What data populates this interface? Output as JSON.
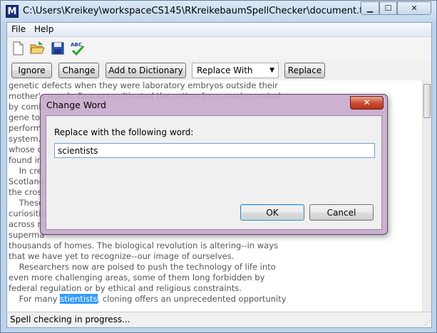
{
  "window": {
    "app_icon": "M",
    "title": "C:\\Users\\Kreikey\\workspaceCS145\\RKreikebaumSpellChecker\\document.txt",
    "min_glyph": "▁",
    "max_glyph": "☐",
    "close_glyph": "✕"
  },
  "menu": {
    "file": "File",
    "help": "Help"
  },
  "toolbar": {
    "icons": [
      "new-file-icon",
      "open-folder-icon",
      "save-disk-icon",
      "spellcheck-abc-icon"
    ],
    "abc_text": "ABC"
  },
  "actions": {
    "ignore": "Ignore",
    "change": "Change",
    "add_to_dictionary": "Add to Dictionary",
    "combo_value": "Replace With",
    "combo_arrow": "▼",
    "replace": "Replace"
  },
  "document": {
    "lines": [
      "genetic defects when they were laboratory embryos outside their",
      "mother's womb. Farmers cultivated the cotton from seeds created",
      "by comb",
      "gene to",
      "perform",
      "system.",
      "whose c",
      "found in",
      "    In cre",
      "Scotland",
      "the cross",
      "    These",
      "curiositie",
      "across m",
      "superma",
      "thousands of homes. The biological revolution is altering--in ways",
      "that we have yet to recognize--our image of ourselves.",
      "    Researchers now are poised to push the technology of life into",
      "even more challenging areas, some of them long forbidden by",
      "federal regulation or by ethical and religious constraints."
    ],
    "last_line_prefix": "    For many ",
    "last_line_highlight": "stientists",
    "last_line_suffix": ", cloning offers an unprecedented opportunity"
  },
  "status": {
    "text": "Spell checking in progress..."
  },
  "dialog": {
    "title": "Change Word",
    "close_glyph": "✕",
    "label": "Replace with the following word:",
    "input_value": "scientists",
    "ok": "OK",
    "cancel": "Cancel"
  }
}
